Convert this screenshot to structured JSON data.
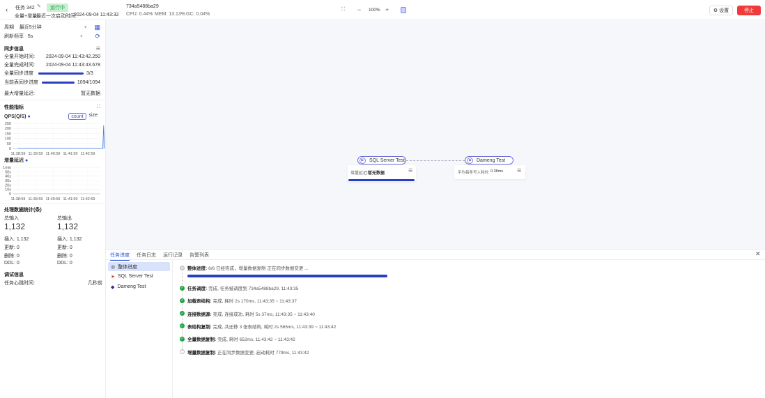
{
  "header": {
    "task_name": "任务 342",
    "status": "运行中",
    "sync_type": "全量+增量",
    "last_start_label": "最近一次启动时间:",
    "last_start": "2024-09-04 11:43:32",
    "agent_id": "734a5488ba29",
    "cpu": "CPU: 0.44%",
    "mem": "MEM: 13.13%",
    "gc": "GC: 0.04%",
    "zoom": "100%",
    "settings": "设置",
    "stop": "停止"
  },
  "filters": {
    "period_label": "周期",
    "period_value": "最近5分钟",
    "refresh_label": "刷新频率",
    "refresh_value": "5s"
  },
  "sync_info": {
    "title": "同步信息",
    "rows": [
      {
        "label": "全量开始时间:",
        "value": "2024-09-04 11:43:42.250"
      },
      {
        "label": "全量完成时间:",
        "value": "2024-09-04 11:43:43.678"
      }
    ],
    "full_progress_label": "全量同步进度",
    "full_progress_text": "3/3",
    "full_progress": 1.0,
    "table_progress_label": "当前表同步进度",
    "table_progress_text": "1094/1094",
    "table_progress": 1.0,
    "max_delay_label": "最大增量延迟:",
    "max_delay_value": "暂无数据"
  },
  "perf": {
    "title": "性能指标",
    "qps_label": "QPS(Q/S)",
    "count": "count",
    "size": "size",
    "delay_label": "增量延迟"
  },
  "chart_data": [
    {
      "type": "line",
      "title": "QPS(Q/S)",
      "yticks": [
        "250",
        "200",
        "150",
        "100",
        "50",
        "0"
      ],
      "ylim": [
        0,
        250
      ],
      "categories": [
        "11:38:59",
        "11:39:59",
        "11:40:59",
        "11:41:59",
        "11:42:59"
      ],
      "series": [
        {
          "name": "count",
          "x_minutes": [
            0,
            4.9,
            4.95,
            5.0
          ],
          "values": [
            0,
            0,
            230,
            0
          ]
        }
      ]
    },
    {
      "type": "line",
      "title": "增量延迟",
      "yticks": [
        "1min",
        "50s",
        "40s",
        "30s",
        "20s",
        "10s",
        "0"
      ],
      "ylim": [
        0,
        60
      ],
      "categories": [
        "11:38:59",
        "11:39:59",
        "11:40:59",
        "11:41:59",
        "11:42:59"
      ],
      "series": []
    }
  ],
  "stats": {
    "title": "处理数据统计(条)",
    "input_label": "总输入",
    "input_total": "1,132",
    "output_label": "总输出",
    "output_total": "1,132",
    "input_rows": [
      "插入: 1,132",
      "更新: 0",
      "删除: 0",
      "DDL: 0"
    ],
    "output_rows": [
      "插入: 1,132",
      "更新: 0",
      "删除: 0",
      "DDL: 0"
    ]
  },
  "debug": {
    "title": "调试信息",
    "heartbeat_label": "任务心跳时间:",
    "heartbeat_value": "几秒前"
  },
  "dag": {
    "source": "SQL Server Test",
    "source_metric_label": "增量延迟:",
    "source_metric_value": "暂无数据",
    "target": "Dameng Test",
    "target_metric_label": "平均每条写入耗时:",
    "target_metric_value": "0.38ms"
  },
  "bottom": {
    "tabs": [
      "任务进度",
      "任务日志",
      "运行记录",
      "告警列表"
    ],
    "nodes": [
      "整体进度",
      "SQL Server Test",
      "Dameng Test"
    ],
    "overall_label": "整体进度:",
    "overall_text": "6/6 已经完成，增量数据复制 正在同步数据变更 ...",
    "overall_progress": 1.0,
    "steps": [
      {
        "label": "任务调度:",
        "text": "完成, 任务被调度到 734a5488ba29, 11:43:35"
      },
      {
        "label": "加载表结构:",
        "text": "完成, 耗时 2s 170ms, 11:43:35 ~ 11:43:37"
      },
      {
        "label": "连接数据源:",
        "text": "完成, 连接成功, 耗时 5s 37ms, 11:43:35 ~ 11:43:40"
      },
      {
        "label": "表结构复制:",
        "text": "完成, 共迁移 3 张表结构, 耗时 2s 565ms, 11:43:39 ~ 11:43:42"
      },
      {
        "label": "全量数据复制:",
        "text": "完成, 耗时 652ms, 11:43:42 ~ 11:43:42"
      },
      {
        "label": "增量数据复制:",
        "text": "正在同步数据变更, 启动耗时 779ms, 11:43:42"
      }
    ]
  }
}
